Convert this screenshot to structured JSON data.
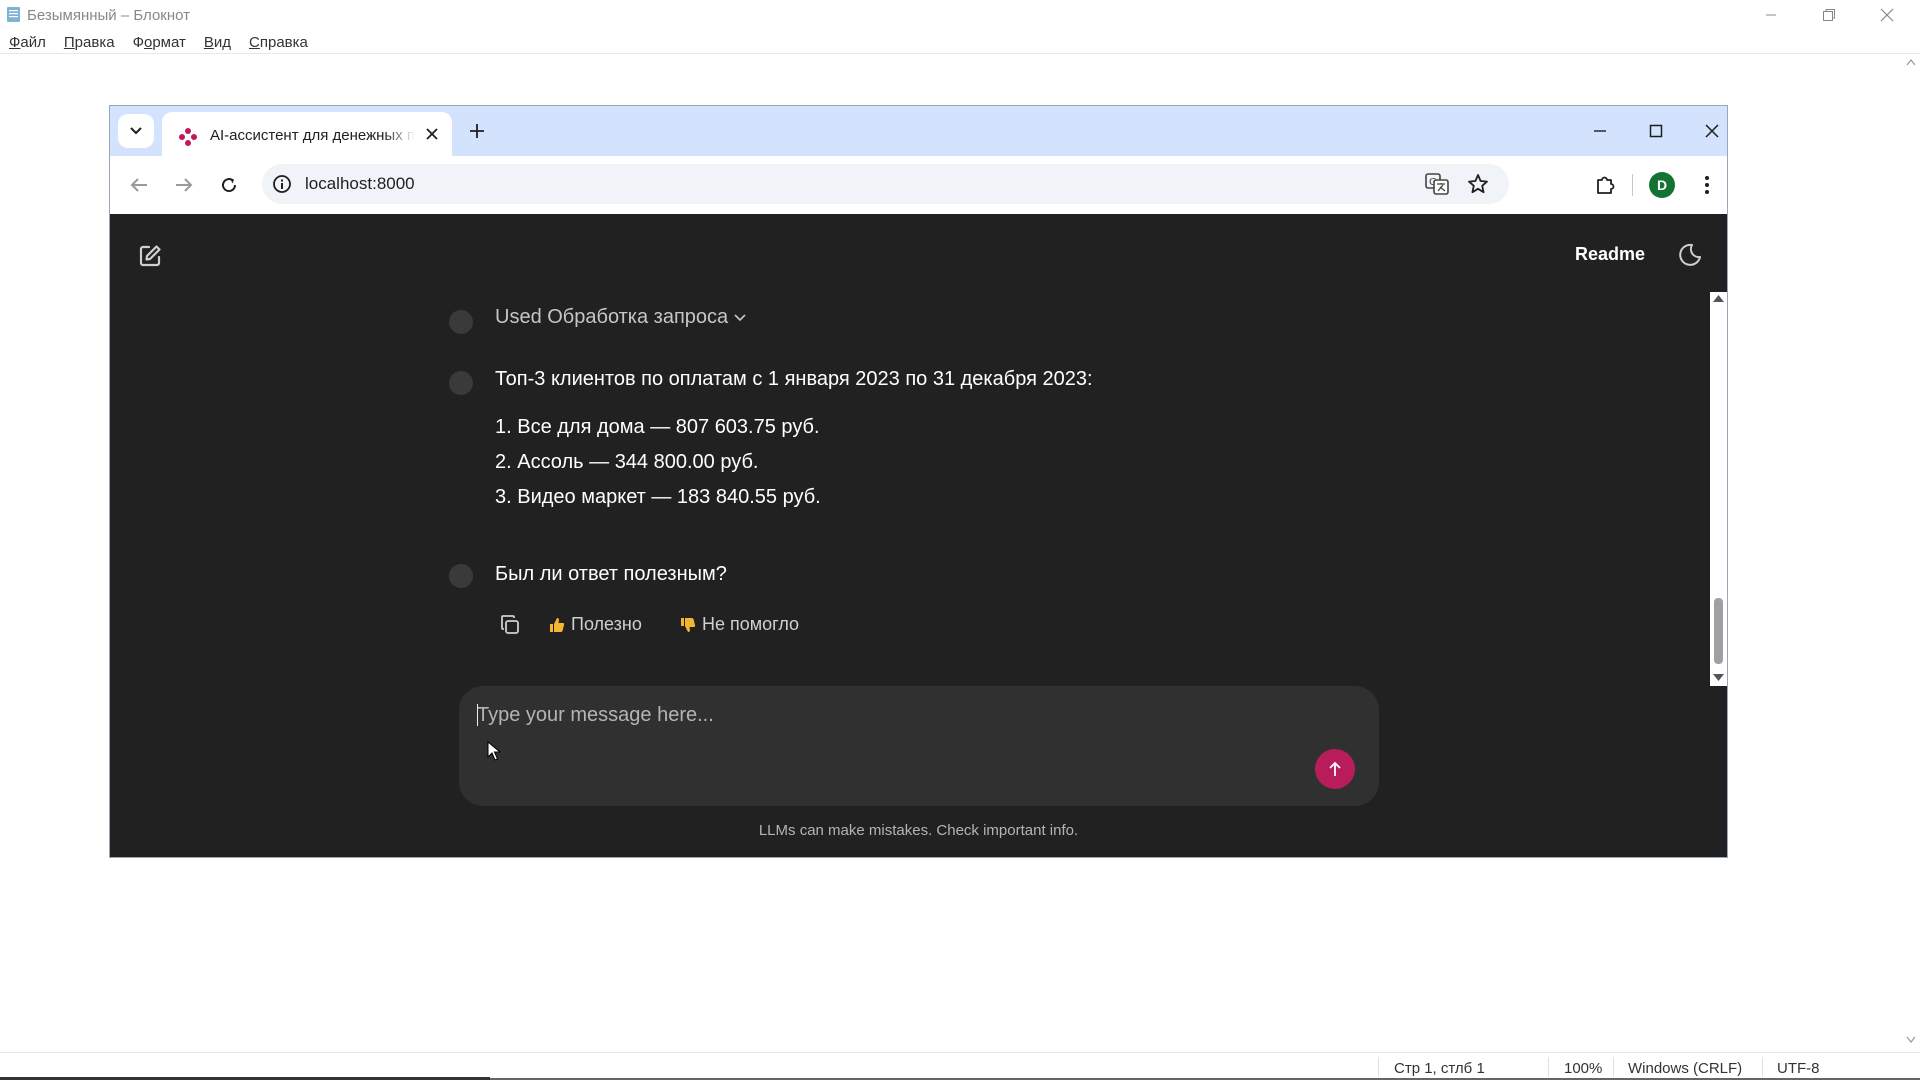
{
  "notepad": {
    "title": "Безымянный – Блокнот",
    "menu": [
      {
        "label": "Файл",
        "accel": "Ф"
      },
      {
        "label": "Правка",
        "accel": "П"
      },
      {
        "label": "Формат",
        "accel": "о"
      },
      {
        "label": "Вид",
        "accel": "В"
      },
      {
        "label": "Справка",
        "accel": "С"
      }
    ],
    "status": {
      "position": "Стр 1, стлб 1",
      "zoom": "100%",
      "line_endings": "Windows (CRLF)",
      "encoding": "UTF-8"
    }
  },
  "browser": {
    "tab_title": "AI-ассистент для денежных поступлений",
    "url": "localhost:8000",
    "profile_initial": "D",
    "accent_color": "#d3e3fd"
  },
  "page": {
    "header": {
      "readme": "Readme"
    },
    "messages": {
      "used": "Used Обработка запроса",
      "heading": "Топ-3 клиентов по оплатам с 1 января 2023 по 31 декабря 2023:",
      "items": [
        "1. Все для дома — 807 603.75 руб.",
        "2. Ассоль — 344 800.00 руб.",
        "3. Видео маркет — 183 840.55 руб."
      ],
      "question": "Был ли ответ полезным?"
    },
    "actions": {
      "helpful": "Полезно",
      "not_helpful": "Не помогло"
    },
    "composer": {
      "placeholder": "Type your message here..."
    },
    "disclaimer": "LLMs can make mistakes. Check important info.",
    "send_color": "#b81c5a",
    "background": "#212121"
  }
}
